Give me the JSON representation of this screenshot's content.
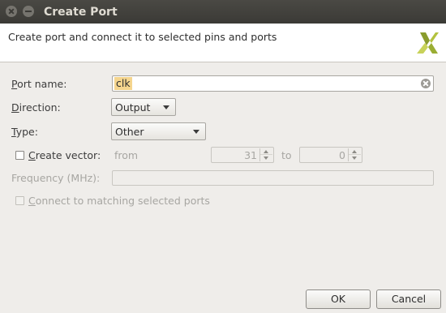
{
  "window": {
    "title": "Create Port"
  },
  "header": {
    "description": "Create port and connect it to selected pins and ports",
    "logo_icon": "xilinx-logo-icon"
  },
  "form": {
    "port_name": {
      "label_mn": "P",
      "label_rest": "ort name:",
      "value": "clk"
    },
    "direction": {
      "label_mn": "D",
      "label_rest": "irection:",
      "selected": "Output"
    },
    "type": {
      "label_mn": "T",
      "label_rest": "ype:",
      "selected": "Other"
    },
    "create_vector": {
      "label_mn": "C",
      "label_rest": "reate vector:",
      "checked": false,
      "from_label": "from",
      "from_value": "31",
      "to_label": "to",
      "to_value": "0"
    },
    "frequency": {
      "label": "Frequency (MHz):",
      "value": ""
    },
    "connect_matching": {
      "label_mn": "C",
      "label_rest": "onnect to matching selected ports",
      "checked": false
    }
  },
  "buttons": {
    "ok": "OK",
    "cancel": "Cancel"
  }
}
